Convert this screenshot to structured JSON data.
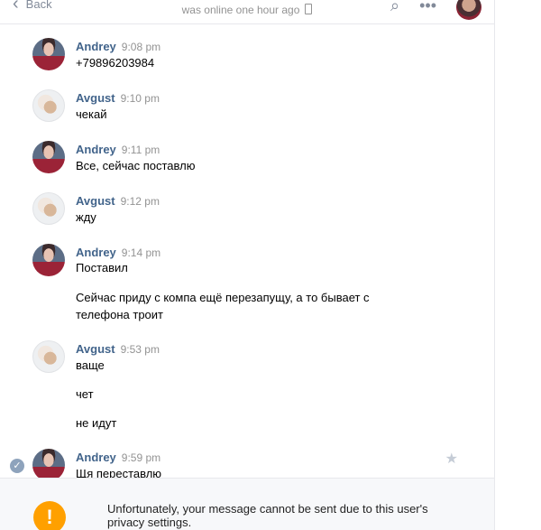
{
  "header": {
    "back_label": "Back",
    "status": "was online one hour ago"
  },
  "messages": [
    {
      "author": "Andrey",
      "time": "9:08 pm",
      "lines": [
        "+79896203984"
      ]
    },
    {
      "author": "Avgust",
      "time": "9:10 pm",
      "lines": [
        "чекай"
      ]
    },
    {
      "author": "Andrey",
      "time": "9:11 pm",
      "lines": [
        "Все, сейчас поставлю"
      ]
    },
    {
      "author": "Avgust",
      "time": "9:12 pm",
      "lines": [
        "жду"
      ]
    },
    {
      "author": "Andrey",
      "time": "9:14 pm",
      "lines": [
        "Поставил",
        "Сейчас приду с компа ещё перезапущу, а то бывает с",
        "телефона троит"
      ]
    },
    {
      "author": "Avgust",
      "time": "9:53 pm",
      "lines": [
        "ваще",
        "чет",
        "не идут"
      ]
    },
    {
      "author": "Andrey",
      "time": "9:59 pm",
      "lines": [
        "Щя переставлю"
      ]
    }
  ],
  "notice": {
    "text_line1": "Unfortunately, your message cannot be sent due to this user's",
    "text_line2": "privacy settings."
  },
  "icons": {
    "back": "chevron-left-icon",
    "search": "search-icon",
    "more": "more-icon",
    "phone": "phone-icon",
    "selected": "check-icon",
    "favorite": "star-icon",
    "warning": "warning-icon"
  }
}
